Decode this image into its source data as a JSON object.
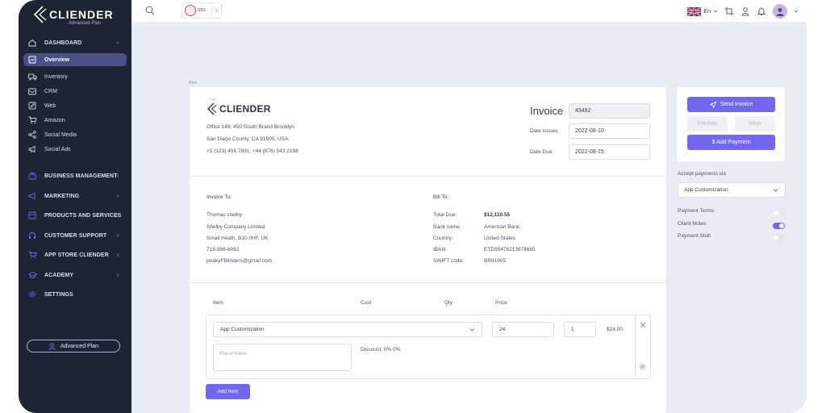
{
  "brand": {
    "name": "CLIENDER",
    "plan": "Advanced Plan"
  },
  "sidebar": {
    "items": [
      {
        "label": "DASHBOARD",
        "icon": "home-icon",
        "type": "group"
      },
      {
        "label": "Overview",
        "icon": "chart-icon",
        "type": "active"
      },
      {
        "label": "Inventory",
        "icon": "truck-icon",
        "type": "sub"
      },
      {
        "label": "CRM",
        "icon": "mail-icon",
        "type": "sub"
      },
      {
        "label": "Web",
        "icon": "edit-icon",
        "type": "sub"
      },
      {
        "label": "Amazon",
        "icon": "cart-icon",
        "type": "sub"
      },
      {
        "label": "Social Media",
        "icon": "share-icon",
        "type": "sub"
      },
      {
        "label": "Social Ads",
        "icon": "megaphone-icon",
        "type": "sub"
      },
      {
        "label": "BUSINESS MANAGEMENT",
        "icon": "briefcase-icon",
        "type": "group"
      },
      {
        "label": "MARKETING",
        "icon": "megaphone-icon",
        "type": "group"
      },
      {
        "label": "PRODUCTS AND SERVICES",
        "icon": "box-icon",
        "type": "group"
      },
      {
        "label": "CUSTOMER SUPPORT",
        "icon": "headset-icon",
        "type": "group"
      },
      {
        "label": "APP STORE CLIENDER",
        "icon": "cart-icon",
        "type": "group"
      },
      {
        "label": "ACADEMY",
        "icon": "graduation-icon",
        "type": "group"
      },
      {
        "label": "SETTINGS",
        "icon": "gear-icon",
        "type": "group"
      }
    ],
    "plan_button": "Advanced Plan"
  },
  "topbar": {
    "org_name": "SBC",
    "language": "En"
  },
  "content": {
    "row_label": "Row"
  },
  "invoice": {
    "logo_label": "Logo",
    "logo_text": "CLIENDER",
    "address": [
      "Office 149, 450 South Brand Brooklyn",
      "San Diego County, CA 91905, USA",
      "+1 (123) 456 7891, +44 (876) 543 2198"
    ],
    "title": "Invoice",
    "number": "#3492",
    "date_issues_label": "Date Issues",
    "date_issues": "2022-08-10",
    "date_due_label": "Date Due",
    "date_due": "2022-08-15",
    "invoice_to": {
      "title": "Invoice To:",
      "lines": [
        "Thomas shelby",
        "Shelby Company Limited",
        "Small Heath, B10 0HF, UK",
        "718-986-6062",
        "peakyFBlinders@gmail.com"
      ]
    },
    "bill_to": {
      "title": "Bill To:",
      "rows": [
        {
          "label": "Total Due:",
          "value": "$12,110.55"
        },
        {
          "label": "Bank name:",
          "value": "American Bank"
        },
        {
          "label": "Country:",
          "value": "United States"
        },
        {
          "label": "IBAN:",
          "value": "ETD95476213874685"
        },
        {
          "label": "SWIFT code:",
          "value": "BR91905"
        }
      ]
    },
    "columns": {
      "item": "Item",
      "cost": "Cost",
      "qty": "Qty",
      "price": "Price"
    },
    "line_item": {
      "item": "App Customization",
      "cost": "24",
      "qty": "1",
      "price": "$24.00",
      "description_placeholder": "Placeholder",
      "discount": "Discount: 0% 0%"
    },
    "add_item_label": "Add Item"
  },
  "actions": {
    "send_invoice": "Send Invoice",
    "preview": "Preview",
    "save": "Save",
    "add_payment": "$ Add Payment",
    "accept_label": "Accept payments via",
    "accept_value": "App Customization",
    "toggles": [
      {
        "label": "Payment Terms",
        "on": false
      },
      {
        "label": "Client Notes",
        "on": true
      },
      {
        "label": "Payment Stub",
        "on": false
      }
    ]
  },
  "colors": {
    "sidebar": "#1d2434",
    "accent": "#7367f0",
    "background": "#e8ecf4"
  }
}
